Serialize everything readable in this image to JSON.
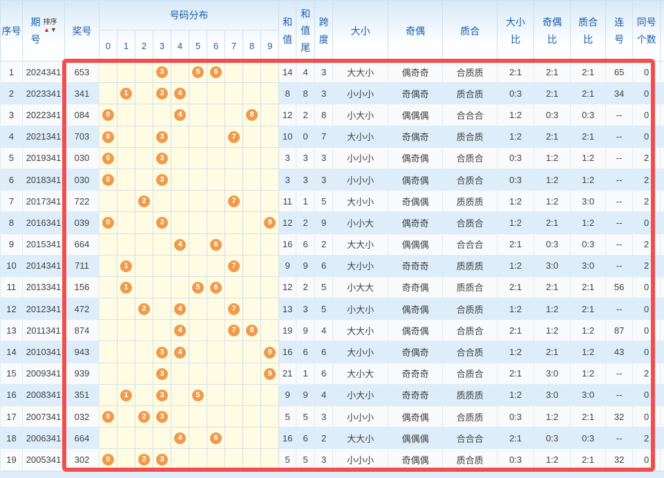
{
  "header": {
    "col_seq": "序号",
    "col_period": "期号",
    "sort_label": "排序",
    "sort_up": "▲",
    "sort_down": "▼",
    "col_prize": "奖号",
    "col_distribution": "号码分布",
    "digits": [
      "0",
      "1",
      "2",
      "3",
      "4",
      "5",
      "6",
      "7",
      "8",
      "9"
    ],
    "col_sum": "和值",
    "col_sum_tail": "和值尾",
    "col_span": "跨度",
    "col_size": "大小",
    "col_parity": "奇偶",
    "col_prime": "质合",
    "col_size_ratio": "大小比",
    "col_parity_ratio": "奇偶比",
    "col_prime_ratio": "质合比",
    "col_consecutive": "连号",
    "col_same_count": "同号个数"
  },
  "colors": {
    "header_text": "#1a5dab",
    "row_bg": "#f9fafb",
    "row_alt_bg": "#ddeefa",
    "distribution_bg": "#fffce3",
    "ball": "#f09a4b",
    "highlight_border": "#f24e4e",
    "sort_arrow_up": "#cc2222",
    "sort_arrow_down": "#444444"
  },
  "rows": [
    {
      "seq": "1",
      "period": "2024341",
      "prize": "653",
      "balls": [
        3,
        5,
        6
      ],
      "sum": "14",
      "tail": "4",
      "span": "3",
      "size": "大大小",
      "parity": "偶奇奇",
      "prime": "合质质",
      "size_ratio": "2:1",
      "parity_ratio": "2:1",
      "prime_ratio": "2:1",
      "consecutive": "65",
      "same": "0"
    },
    {
      "seq": "2",
      "period": "2023341",
      "prize": "341",
      "balls": [
        1,
        3,
        4
      ],
      "sum": "8",
      "tail": "8",
      "span": "3",
      "size": "小小小",
      "parity": "奇偶奇",
      "prime": "质合质",
      "size_ratio": "0:3",
      "parity_ratio": "2:1",
      "prime_ratio": "2:1",
      "consecutive": "34",
      "same": "0"
    },
    {
      "seq": "3",
      "period": "2022341",
      "prize": "084",
      "balls": [
        0,
        4,
        8
      ],
      "sum": "12",
      "tail": "2",
      "span": "8",
      "size": "小大小",
      "parity": "偶偶偶",
      "prime": "合合合",
      "size_ratio": "1:2",
      "parity_ratio": "0:3",
      "prime_ratio": "0:3",
      "consecutive": "--",
      "same": "0"
    },
    {
      "seq": "4",
      "period": "2021341",
      "prize": "703",
      "balls": [
        0,
        3,
        7
      ],
      "sum": "10",
      "tail": "0",
      "span": "7",
      "size": "大小小",
      "parity": "奇偶奇",
      "prime": "质合质",
      "size_ratio": "1:2",
      "parity_ratio": "2:1",
      "prime_ratio": "2:1",
      "consecutive": "--",
      "same": "0"
    },
    {
      "seq": "5",
      "period": "2019341",
      "prize": "030",
      "balls": [
        0,
        3
      ],
      "sum": "3",
      "tail": "3",
      "span": "3",
      "size": "小小小",
      "parity": "偶奇偶",
      "prime": "合质合",
      "size_ratio": "0:3",
      "parity_ratio": "1:2",
      "prime_ratio": "1:2",
      "consecutive": "--",
      "same": "2"
    },
    {
      "seq": "6",
      "period": "2018341",
      "prize": "030",
      "balls": [
        0,
        3
      ],
      "sum": "3",
      "tail": "3",
      "span": "3",
      "size": "小小小",
      "parity": "偶奇偶",
      "prime": "合质合",
      "size_ratio": "0:3",
      "parity_ratio": "1:2",
      "prime_ratio": "1:2",
      "consecutive": "--",
      "same": "2"
    },
    {
      "seq": "7",
      "period": "2017341",
      "prize": "722",
      "balls": [
        2,
        7
      ],
      "sum": "11",
      "tail": "1",
      "span": "5",
      "size": "大小小",
      "parity": "奇偶偶",
      "prime": "质质质",
      "size_ratio": "1:2",
      "parity_ratio": "1:2",
      "prime_ratio": "3:0",
      "consecutive": "--",
      "same": "2"
    },
    {
      "seq": "8",
      "period": "2016341",
      "prize": "039",
      "balls": [
        0,
        3,
        9
      ],
      "sum": "12",
      "tail": "2",
      "span": "9",
      "size": "小小大",
      "parity": "偶奇奇",
      "prime": "合质合",
      "size_ratio": "1:2",
      "parity_ratio": "2:1",
      "prime_ratio": "1:2",
      "consecutive": "--",
      "same": "0"
    },
    {
      "seq": "9",
      "period": "2015341",
      "prize": "664",
      "balls": [
        4,
        6
      ],
      "sum": "16",
      "tail": "6",
      "span": "2",
      "size": "大大小",
      "parity": "偶偶偶",
      "prime": "合合合",
      "size_ratio": "2:1",
      "parity_ratio": "0:3",
      "prime_ratio": "0:3",
      "consecutive": "--",
      "same": "2"
    },
    {
      "seq": "10",
      "period": "2014341",
      "prize": "711",
      "balls": [
        1,
        7
      ],
      "sum": "9",
      "tail": "9",
      "span": "6",
      "size": "大小小",
      "parity": "奇奇奇",
      "prime": "质质质",
      "size_ratio": "1:2",
      "parity_ratio": "3:0",
      "prime_ratio": "3:0",
      "consecutive": "--",
      "same": "2"
    },
    {
      "seq": "11",
      "period": "2013341",
      "prize": "156",
      "balls": [
        1,
        5,
        6
      ],
      "sum": "12",
      "tail": "2",
      "span": "5",
      "size": "小大大",
      "parity": "奇奇偶",
      "prime": "质质合",
      "size_ratio": "2:1",
      "parity_ratio": "2:1",
      "prime_ratio": "2:1",
      "consecutive": "56",
      "same": "0"
    },
    {
      "seq": "12",
      "period": "2012341",
      "prize": "472",
      "balls": [
        2,
        4,
        7
      ],
      "sum": "13",
      "tail": "3",
      "span": "5",
      "size": "小大小",
      "parity": "偶奇偶",
      "prime": "合质质",
      "size_ratio": "1:2",
      "parity_ratio": "1:2",
      "prime_ratio": "2:1",
      "consecutive": "--",
      "same": "0"
    },
    {
      "seq": "13",
      "period": "2011341",
      "prize": "874",
      "balls": [
        4,
        7,
        8
      ],
      "sum": "19",
      "tail": "9",
      "span": "4",
      "size": "大大小",
      "parity": "偶奇偶",
      "prime": "合质合",
      "size_ratio": "2:1",
      "parity_ratio": "1:2",
      "prime_ratio": "1:2",
      "consecutive": "87",
      "same": "0"
    },
    {
      "seq": "14",
      "period": "2010341",
      "prize": "943",
      "balls": [
        3,
        4,
        9
      ],
      "sum": "16",
      "tail": "6",
      "span": "6",
      "size": "大小小",
      "parity": "奇偶奇",
      "prime": "合合质",
      "size_ratio": "1:2",
      "parity_ratio": "2:1",
      "prime_ratio": "1:2",
      "consecutive": "43",
      "same": "0"
    },
    {
      "seq": "15",
      "period": "2009341",
      "prize": "939",
      "balls": [
        3,
        9
      ],
      "sum": "21",
      "tail": "1",
      "span": "6",
      "size": "大小大",
      "parity": "奇奇奇",
      "prime": "合质合",
      "size_ratio": "2:1",
      "parity_ratio": "3:0",
      "prime_ratio": "1:2",
      "consecutive": "--",
      "same": "2"
    },
    {
      "seq": "16",
      "period": "2008341",
      "prize": "351",
      "balls": [
        1,
        3,
        5
      ],
      "sum": "9",
      "tail": "9",
      "span": "4",
      "size": "小大小",
      "parity": "奇奇奇",
      "prime": "质质质",
      "size_ratio": "1:2",
      "parity_ratio": "3:0",
      "prime_ratio": "3:0",
      "consecutive": "--",
      "same": "0"
    },
    {
      "seq": "17",
      "period": "2007341",
      "prize": "032",
      "balls": [
        0,
        2,
        3
      ],
      "sum": "5",
      "tail": "5",
      "span": "3",
      "size": "小小小",
      "parity": "偶奇偶",
      "prime": "合质质",
      "size_ratio": "0:3",
      "parity_ratio": "1:2",
      "prime_ratio": "2:1",
      "consecutive": "32",
      "same": "0"
    },
    {
      "seq": "18",
      "period": "2006341",
      "prize": "664",
      "balls": [
        4,
        6
      ],
      "sum": "16",
      "tail": "6",
      "span": "2",
      "size": "大大小",
      "parity": "偶偶偶",
      "prime": "合合合",
      "size_ratio": "2:1",
      "parity_ratio": "0:3",
      "prime_ratio": "0:3",
      "consecutive": "--",
      "same": "2"
    },
    {
      "seq": "19",
      "period": "2005341",
      "prize": "302",
      "balls": [
        0,
        2,
        3
      ],
      "sum": "5",
      "tail": "5",
      "span": "3",
      "size": "小小小",
      "parity": "奇偶偶",
      "prime": "质合质",
      "size_ratio": "0:3",
      "parity_ratio": "1:2",
      "prime_ratio": "2:1",
      "consecutive": "32",
      "same": "0"
    }
  ]
}
